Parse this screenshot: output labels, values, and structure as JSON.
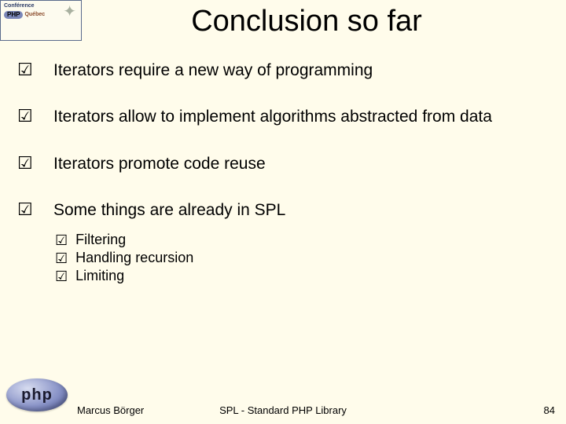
{
  "corner": {
    "line1": "Conférence",
    "php": "PHP",
    "quebec": "Québec"
  },
  "title": "Conclusion so far",
  "points": [
    {
      "text": "Iterators require a new way of programming",
      "sub": []
    },
    {
      "text": "Iterators allow to implement algorithms abstracted from data",
      "sub": []
    },
    {
      "text": "Iterators promote code reuse",
      "sub": []
    },
    {
      "text": "Some things are already in SPL",
      "sub": [
        "Filtering",
        "Handling recursion",
        "Limiting"
      ]
    }
  ],
  "footer": {
    "author": "Marcus Börger",
    "center": "SPL - Standard PHP Library",
    "page": "84",
    "logo_text": "php"
  },
  "glyph": {
    "check": "☑"
  }
}
